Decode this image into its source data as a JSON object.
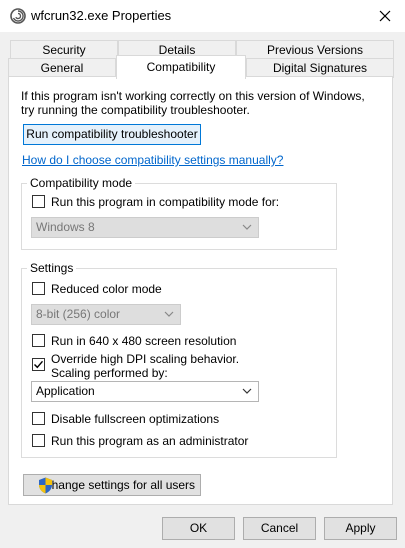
{
  "window": {
    "title": "wfcrun32.exe Properties",
    "icon": "app-spiral-icon",
    "close_icon": "close-icon"
  },
  "tabs": {
    "row1": [
      {
        "label": "Security"
      },
      {
        "label": "Details"
      },
      {
        "label": "Previous Versions"
      }
    ],
    "row2": [
      {
        "label": "General"
      },
      {
        "label": "Compatibility",
        "active": true
      },
      {
        "label": "Digital Signatures"
      }
    ]
  },
  "intro": {
    "line1": "If this program isn't working correctly on this version of Windows,",
    "line2": "try running the compatibility troubleshooter."
  },
  "troubleshooter_button": "Run compatibility troubleshooter",
  "help_link": "How do I choose compatibility settings manually?",
  "compat_mode": {
    "group_label": "Compatibility mode",
    "checkbox_label": "Run this program in compatibility mode for:",
    "checked": false,
    "select_value": "Windows 8"
  },
  "settings": {
    "group_label": "Settings",
    "reduced_color": {
      "label": "Reduced color mode",
      "checked": false
    },
    "color_select_value": "8-bit (256) color",
    "res_640": {
      "label": "Run in 640 x 480 screen resolution",
      "checked": false
    },
    "dpi_override": {
      "label_line1": "Override high DPI scaling behavior.",
      "label_line2": "Scaling performed by:",
      "checked": true
    },
    "dpi_select_value": "Application",
    "fullscreen_opt": {
      "label": "Disable fullscreen optimizations",
      "checked": false
    },
    "run_admin": {
      "label": "Run this program as an administrator",
      "checked": false
    }
  },
  "change_all_button": {
    "label": "Change settings for all users",
    "icon": "uac-shield-icon"
  },
  "footer": {
    "ok": "OK",
    "cancel": "Cancel",
    "apply": "Apply"
  }
}
